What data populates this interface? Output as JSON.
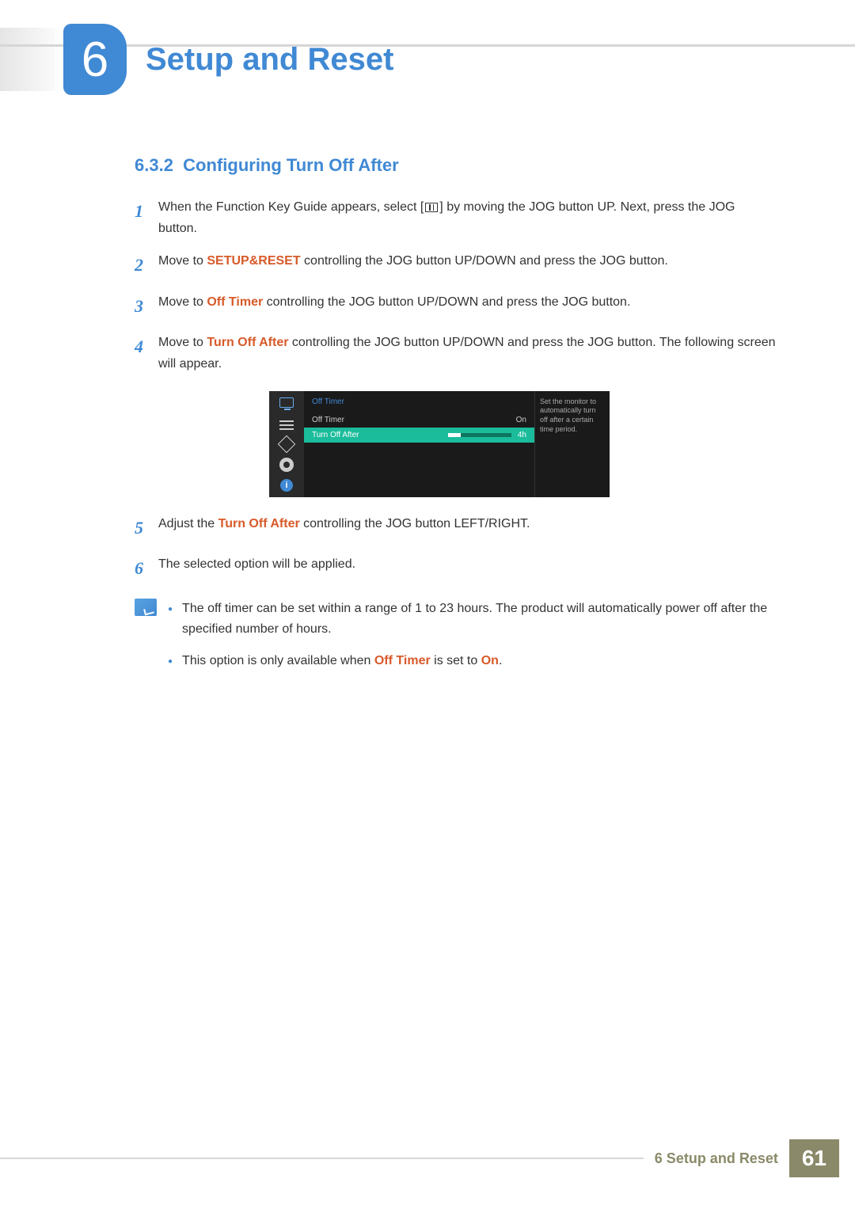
{
  "chapter": {
    "number": "6",
    "title": "Setup and Reset"
  },
  "section": {
    "number": "6.3.2",
    "title": "Configuring Turn Off After"
  },
  "steps": [
    {
      "num": "1",
      "parts": [
        "When the Function Key Guide appears, select [",
        "] by moving the JOG button UP. Next, press the JOG button."
      ]
    },
    {
      "num": "2",
      "prefix": "Move to ",
      "keyword": "SETUP&RESET",
      "suffix": " controlling the JOG button UP/DOWN and press the JOG button."
    },
    {
      "num": "3",
      "prefix": "Move to ",
      "keyword": "Off Timer",
      "suffix": " controlling the JOG button UP/DOWN and press the JOG button."
    },
    {
      "num": "4",
      "prefix": "Move to ",
      "keyword": "Turn Off After",
      "suffix": " controlling the JOG button UP/DOWN and press the JOG button. The following screen will appear."
    },
    {
      "num": "5",
      "prefix": "Adjust the ",
      "keyword": "Turn Off After",
      "suffix": " controlling the JOG button LEFT/RIGHT."
    },
    {
      "num": "6",
      "plain": "The selected option will be applied."
    }
  ],
  "osd": {
    "title": "Off Timer",
    "row1_label": "Off Timer",
    "row1_value": "On",
    "row2_label": "Turn Off After",
    "row2_value": "4h",
    "help": "Set the monitor to automatically turn off after a certain time period."
  },
  "notes": [
    "The off timer can be set within a range of 1 to 23 hours. The product will automatically power off after the specified number of hours.",
    {
      "prefix": "This option is only available when ",
      "k1": "Off Timer",
      "mid": " is set to ",
      "k2": "On",
      "suffix": "."
    }
  ],
  "footer": {
    "chapter_ref": "6 Setup and Reset",
    "page": "61"
  }
}
